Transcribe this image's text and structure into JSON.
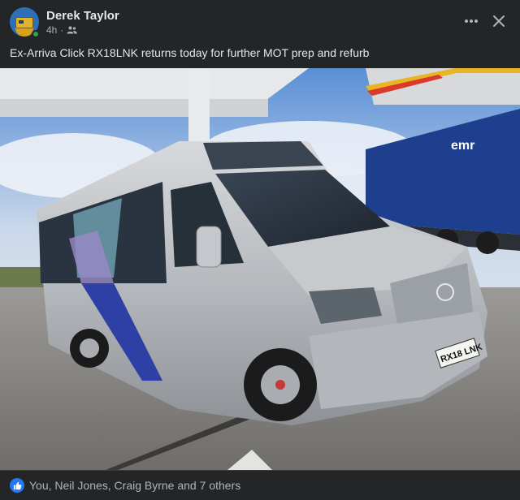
{
  "post": {
    "author": "Derek Taylor",
    "time": "4h",
    "separator": "·",
    "caption": "Ex-Arriva Click RX18LNK returns today for further MOT prep and refurb",
    "reactions_text": "You, Neil Jones, Craig Byrne and 7 others",
    "photo": {
      "plate": "RX18 LNK",
      "truck_brand": "emr"
    }
  },
  "icons": {
    "privacy": "friends-icon",
    "more": "more-horizontal-icon",
    "close": "close-icon",
    "reaction": "like-icon"
  },
  "colors": {
    "background": "#242526",
    "text_primary": "#e4e6eb",
    "text_secondary": "#b0b3b8",
    "like_blue": "#2078f4",
    "online_green": "#31a24c"
  }
}
